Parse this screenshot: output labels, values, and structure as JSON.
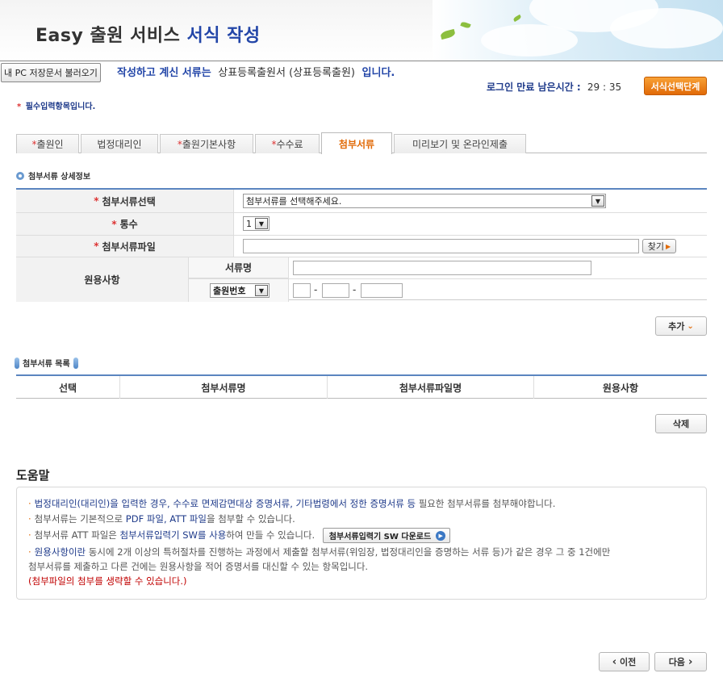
{
  "header": {
    "title_plain": "Easy 출원 서비스",
    "title_accent": "서식 작성"
  },
  "subbar": {
    "load_button": "내 PC 저장문서 불러오기",
    "doc_prefix": "작성하고 계신 서류는",
    "doc_name": "상표등록출원서 (상표등록출원)",
    "doc_suffix": "입니다.",
    "timer_label": "로그인 만료 남은시간 :",
    "timer_value": "29 : 35",
    "form_step_button": "서식선택단계",
    "required_note": "필수입력항목입니다."
  },
  "tabs": [
    {
      "label": "출원인",
      "required": true
    },
    {
      "label": "법정대리인",
      "required": false
    },
    {
      "label": "출원기본사항",
      "required": true
    },
    {
      "label": "수수료",
      "required": true
    },
    {
      "label": "첨부서류",
      "required": false,
      "active": true
    },
    {
      "label": "미리보기 및 온라인제출",
      "required": false
    }
  ],
  "detail": {
    "section_title": "첨부서류 상세정보",
    "attach_select_label": "첨부서류선택",
    "attach_select_value": "첨부서류를 선택해주세요.",
    "copies_label": "통수",
    "copies_value": "1",
    "file_label": "첨부서류파일",
    "file_value": "",
    "find_button": "찾기",
    "reuse_label": "원용사항",
    "docname_label": "서류명",
    "docname_value": "",
    "number_type_value": "출원번호",
    "number_part1": "",
    "number_part2": "",
    "number_part3": "",
    "dash": "-",
    "add_button": "추가"
  },
  "list": {
    "section_title": "첨부서류 목록",
    "columns": [
      "선택",
      "첨부서류명",
      "첨부서류파일명",
      "원용사항"
    ],
    "delete_button": "삭제"
  },
  "help": {
    "title": "도움말",
    "line1_hl": "법정대리인(대리인)을 입력한 경우, 수수료 면제감면대상 증명서류, 기타법령에서 정한 증명서류 등",
    "line1_rest": " 필요한 첨부서류를 첨부해야합니다.",
    "line2_a": "첨부서류는 기본적으로 ",
    "line2_hl": "PDF 파일, ATT 파일",
    "line2_b": "을 첨부할 수 있습니다.",
    "line3_a": "첨부서류 ATT 파일은 ",
    "line3_hl": "첨부서류입력기 SW를 사용",
    "line3_b": "하여 만들 수 있습니다.",
    "download_button": "첨부서류입력기 SW 다운로드",
    "line4_hl": "원용사항이란",
    "line4_rest": " 동시에 2개 이상의 특허절차를 진행하는 과정에서 제출할 첨부서류(위임장, 법정대리인을 증명하는 서류 등)가 같은 경우 그 중 1건에만",
    "line5": "첨부서류를 제출하고 다른 건에는 원용사항을 적어 증명서를 대신할 수 있는 항목입니다.",
    "line6": "(첨부파일의 첨부를 생략할 수 있습니다.)",
    "bullet": "·"
  },
  "nav": {
    "prev_button": "이전",
    "next_button": "다음"
  },
  "icons": {
    "star": "*",
    "select_arrow": "▼",
    "find_arrow": "▶",
    "add_chevron": "⌄",
    "prev_chevron": "‹",
    "next_chevron": "›",
    "download_arrow": "▶"
  },
  "colors": {
    "accent_blue": "#2346a8",
    "accent_orange": "#e16a07",
    "required_red": "#d33333",
    "table_border": "#5b85c0"
  }
}
